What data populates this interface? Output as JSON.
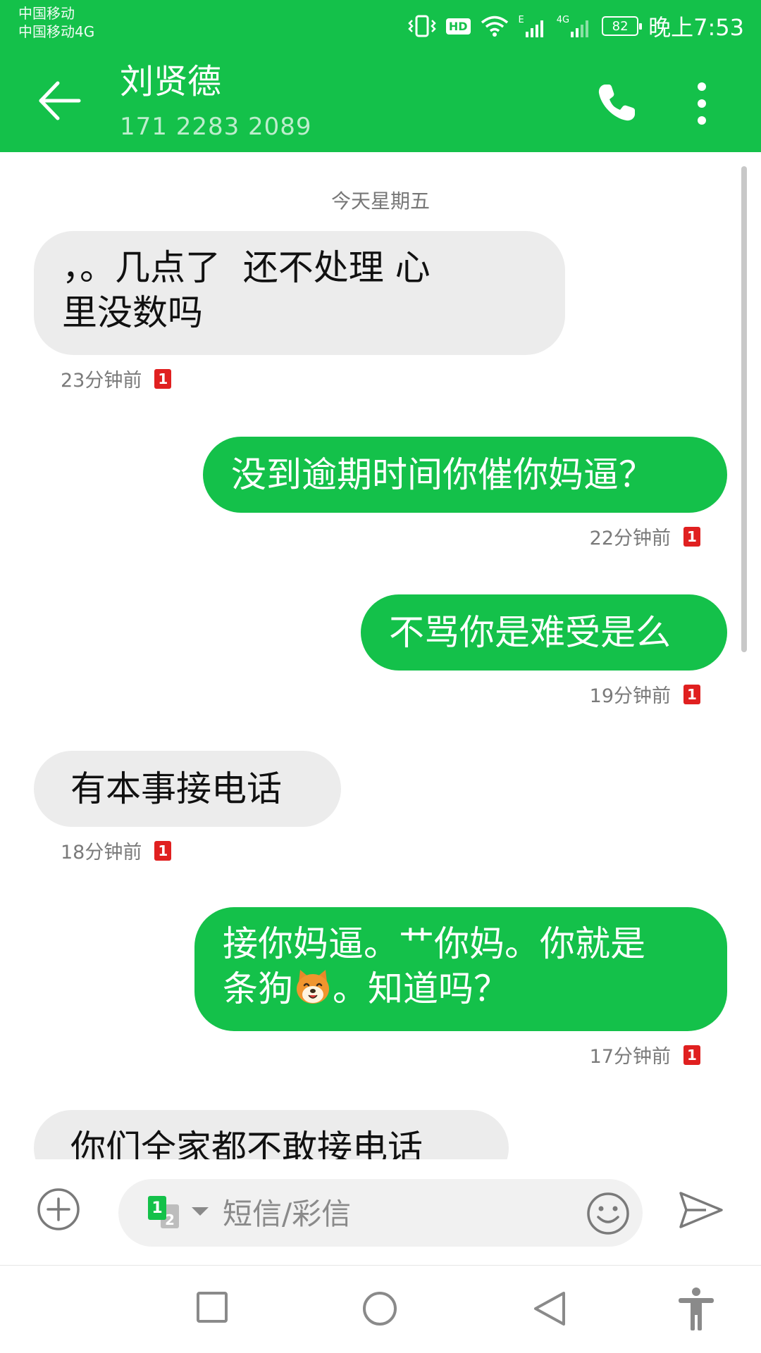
{
  "status_bar": {
    "carrier_1": "中国移动",
    "carrier_2": "中国移动4G",
    "hd_label": "HD",
    "net_1": "E",
    "net_2": "4G",
    "battery": "82",
    "time": "晚上7:53"
  },
  "header": {
    "contact_name": "刘贤德",
    "contact_number": "171 2283 2089"
  },
  "conversation": {
    "date_separator": "今天星期五",
    "messages": [
      {
        "direction": "incoming",
        "text_line1": "，。几点了  还不处理 心",
        "text_line2": "里没数吗",
        "time": "23分钟前",
        "sim": "1"
      },
      {
        "direction": "outgoing",
        "text": "没到逾期时间你催你妈逼？",
        "time": "22分钟前",
        "sim": "1"
      },
      {
        "direction": "outgoing",
        "text": "不骂你是难受是么",
        "time": "19分钟前",
        "sim": "1"
      },
      {
        "direction": "incoming",
        "text": "有本事接电话",
        "time": "18分钟前",
        "sim": "1"
      },
      {
        "direction": "outgoing",
        "text_line1": "接你妈逼。艹你妈。你就是",
        "text_line2a": "条狗",
        "emoji": "dog-face-emoji",
        "text_line2b": "。知道吗？",
        "time": "17分钟前",
        "sim": "1"
      },
      {
        "direction": "incoming",
        "text": "你们全家都不敢接电话",
        "partial": true
      }
    ]
  },
  "composer": {
    "placeholder": "短信/彩信",
    "sim_primary": "1",
    "sim_secondary": "2"
  },
  "colors": {
    "accent": "#14c14a",
    "incoming_bubble": "#ececec",
    "badge_red": "#e02020"
  },
  "icons": [
    "back-arrow-icon",
    "phone-icon",
    "more-vertical-icon",
    "add-circle-icon",
    "emoji-icon",
    "send-icon",
    "nav-square-icon",
    "nav-circle-icon",
    "nav-back-triangle-icon",
    "accessibility-icon"
  ]
}
